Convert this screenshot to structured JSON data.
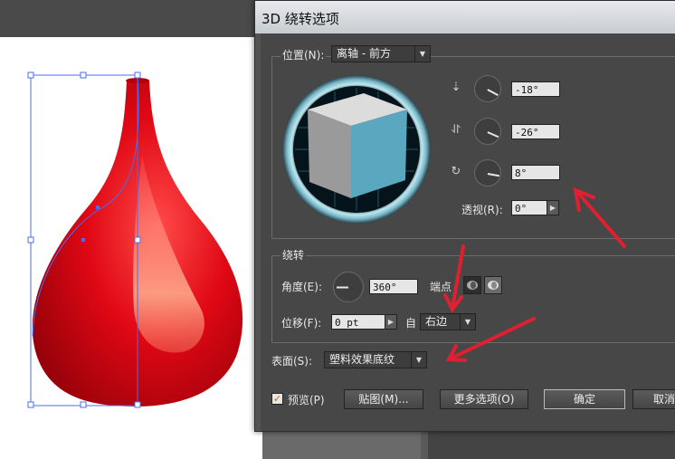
{
  "dialog": {
    "title": "3D 绕转选项",
    "position": {
      "label": "位置(N):",
      "value": "离轴 - 前方",
      "rotation_x": "-18°",
      "rotation_y": "-26°",
      "rotation_z": "8°",
      "perspective_label": "透视(R):",
      "perspective": "0°"
    },
    "revolve": {
      "section_label": "绕转",
      "angle_label": "角度(E):",
      "angle": "360°",
      "cap_label": "端点",
      "offset_label": "位移(F):",
      "offset": "0 pt",
      "from_label": "自",
      "from_value": "右边"
    },
    "surface": {
      "label": "表面(S):",
      "value": "塑料效果底纹"
    },
    "footer": {
      "preview_label": "预览(P)",
      "preview_checked": true,
      "map_art_label": "贴图(M)...",
      "more_options_label": "更多选项(O)",
      "ok_label": "确定",
      "cancel_label": "取消"
    }
  },
  "colors": {
    "vase_red": "#d80010",
    "cube_blue": "#5aa8c0",
    "annotation_arrow": "#e02030"
  }
}
